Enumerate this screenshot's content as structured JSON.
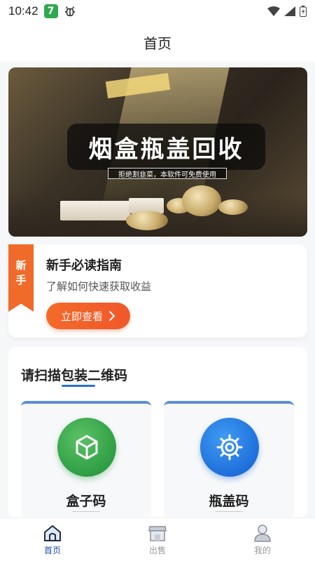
{
  "status_bar": {
    "time": "10:42",
    "badge": "7"
  },
  "header": {
    "title": "首页"
  },
  "banner": {
    "title": "烟盒瓶盖回收",
    "subtitle": "拒绝割韭菜，本软件可免费使用"
  },
  "guide": {
    "ribbon_text": [
      "新",
      "手"
    ],
    "title": "新手必读指南",
    "subtitle": "了解如何快速获取收益",
    "button_label": "立即查看"
  },
  "scan": {
    "title": "请扫描包装二维码",
    "items": [
      {
        "label": "盒子码",
        "icon": "cube-icon",
        "color": "#2f9e44"
      },
      {
        "label": "瓶盖码",
        "icon": "gear-icon",
        "color": "#1f6fdc"
      }
    ]
  },
  "nav": {
    "items": [
      {
        "label": "首页",
        "icon": "home-icon",
        "active": true
      },
      {
        "label": "出售",
        "icon": "store-icon",
        "active": false
      },
      {
        "label": "我的",
        "icon": "user-icon",
        "active": false
      }
    ]
  },
  "colors": {
    "accent": "#f06a2a",
    "brand_blue": "#2b72c9",
    "nav_active": "#1f4fa8"
  }
}
